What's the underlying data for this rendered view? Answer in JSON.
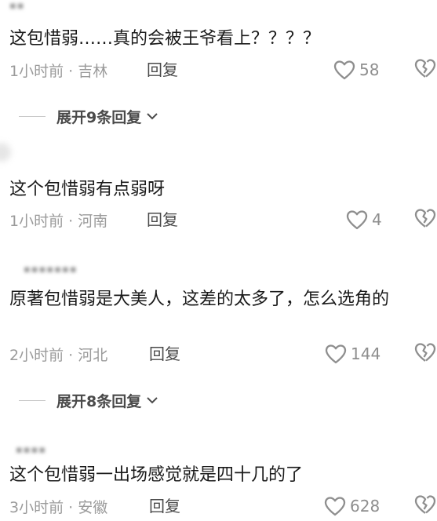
{
  "comments": [
    {
      "text": "这包惜弱……真的会被王爷看上？？？？",
      "time": "1小时前 · 吉林",
      "reply_label": "回复",
      "likes": "58"
    },
    {
      "text": "这个包惜弱有点弱呀",
      "time": "1小时前 · 河南",
      "reply_label": "回复",
      "likes": "4"
    },
    {
      "text": "原著包惜弱是大美人，这差的太多了，怎么选角的",
      "time": "2小时前 · 河北",
      "reply_label": "回复",
      "likes": "144"
    },
    {
      "text": "这个包惜弱一出场感觉就是四十几的了",
      "time": "3小时前 · 安徽",
      "reply_label": "回复",
      "likes": "628"
    }
  ],
  "expand_replies": [
    {
      "label": "展开9条回复"
    },
    {
      "label": "展开8条回复"
    }
  ],
  "icons": {
    "like": "heart-outline-icon",
    "dislike": "broken-heart-icon",
    "expand": "chevron-down-icon"
  },
  "colors": {
    "text": "#1a1a1a",
    "meta": "#9b9b9b",
    "icon": "#8e8e8e"
  }
}
